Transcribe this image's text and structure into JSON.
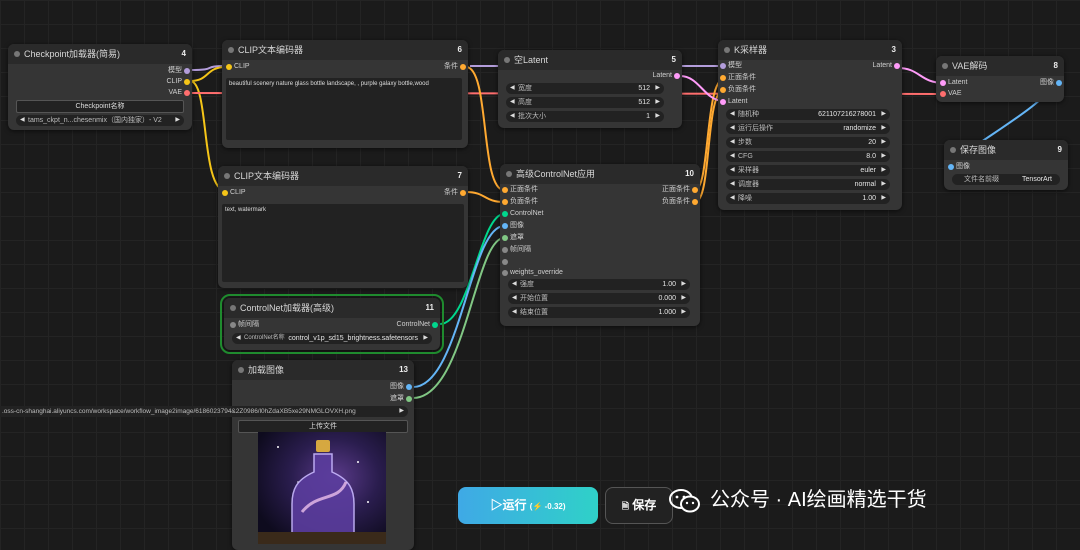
{
  "nodes": {
    "checkpoint": {
      "title": "Checkpoint加载器(简易)",
      "num": "4",
      "outputs": [
        "模型",
        "CLIP",
        "VAE"
      ],
      "button": "Checkpoint名称",
      "value": "tams_ckpt_n...chesenmix（国内独家）- V2"
    },
    "clip1": {
      "title": "CLIP文本编码器",
      "num": "6",
      "input": "CLIP",
      "output": "条件",
      "text": "beautiful scenery nature glass bottle landscape, , purple galaxy bottle,wood"
    },
    "clip2": {
      "title": "CLIP文本编码器",
      "num": "7",
      "input": "CLIP",
      "output": "条件",
      "text": "text, watermark"
    },
    "latent": {
      "title": "空Latent",
      "num": "5",
      "output": "Latent",
      "widgets": [
        {
          "label": "宽度",
          "value": "512"
        },
        {
          "label": "高度",
          "value": "512"
        },
        {
          "label": "批次大小",
          "value": "1"
        }
      ]
    },
    "ksampler": {
      "title": "K采样器",
      "num": "3",
      "inputs": [
        "模型",
        "正面条件",
        "负面条件",
        "Latent"
      ],
      "output": "Latent",
      "widgets": [
        {
          "label": "随机种",
          "value": "621107216278001"
        },
        {
          "label": "运行后操作",
          "value": "randomize"
        },
        {
          "label": "步数",
          "value": "20"
        },
        {
          "label": "CFG",
          "value": "8.0"
        },
        {
          "label": "采样器",
          "value": "euler"
        },
        {
          "label": "调度器",
          "value": "normal"
        },
        {
          "label": "降噪",
          "value": "1.00"
        }
      ]
    },
    "vae": {
      "title": "VAE解码",
      "num": "8",
      "inputs": [
        "Latent",
        "VAE"
      ],
      "output": "图像"
    },
    "save": {
      "title": "保存图像",
      "num": "9",
      "input": "图像",
      "label": "文件名前缀",
      "value": "TensorArt"
    },
    "controlnet": {
      "title": "高级ControlNet应用",
      "num": "10",
      "inputs": [
        "正面条件",
        "负面条件",
        "ControlNet",
        "图像",
        "遮罩",
        "帧间隔",
        "",
        "weights_override"
      ],
      "outputs": [
        "正面条件",
        "负面条件"
      ],
      "widgets": [
        {
          "label": "强度",
          "value": "1.00"
        },
        {
          "label": "开始位置",
          "value": "0.000"
        },
        {
          "label": "结束位置",
          "value": "1.000"
        }
      ]
    },
    "cnloader": {
      "title": "ControlNet加载器(高级)",
      "num": "11",
      "input": "帧间隔",
      "output": "ControlNet",
      "label": "ControlNet名称",
      "value": "control_v1p_sd15_brightness.safetensors"
    },
    "loadimg": {
      "title": "加载图像",
      "num": "13",
      "outputs": [
        "图像",
        "遮罩"
      ],
      "path": ".oss-cn-shanghai.aliyuncs.com/workspace/workflow_image2image/6186023794&2Z0986/l0hZdaXB5xe29NMGLOVXH.png",
      "upload": "上传文件"
    }
  },
  "toolbar": {
    "run_label": "▷运行",
    "run_cost": "(⚡ -0.32)",
    "save_label": "保存"
  },
  "watermark": "公众号 · AI绘画精选干货",
  "colors": {
    "clip": "#f5c518",
    "model": "#b39ddb",
    "vae": "#ff6e6e",
    "cond": "#ffa931",
    "latent": "#ff9cf9",
    "image": "#64b5f6",
    "mask": "#81c784",
    "controlnet": "#00d78d"
  }
}
